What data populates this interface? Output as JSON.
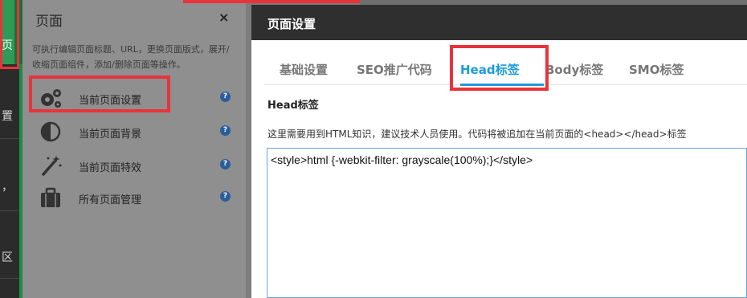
{
  "left_strip": {
    "active_glyph": "页",
    "glyphs": [
      "置",
      "，",
      "区"
    ]
  },
  "page_panel": {
    "title": "页面",
    "close": "×",
    "description": "可执行编辑页面标题、URL，更换页面版式，展开/收缩页面组件，添加/删除页面等操作。",
    "items": [
      {
        "label": "当前页面设置",
        "icon": "gears-icon",
        "help": "?"
      },
      {
        "label": "当前页面背景",
        "icon": "contrast-icon",
        "help": "?"
      },
      {
        "label": "当前页面特效",
        "icon": "magic-wand-icon",
        "help": "?"
      },
      {
        "label": "所有页面管理",
        "icon": "briefcase-icon",
        "help": "?"
      }
    ]
  },
  "dialog": {
    "title": "页面设置",
    "tabs": [
      {
        "label": "基础设置",
        "active": false
      },
      {
        "label": "SEO推广代码",
        "active": false
      },
      {
        "label": "Head标签",
        "active": true
      },
      {
        "label": "Body标签",
        "active": false
      },
      {
        "label": "SMO标签",
        "active": false
      }
    ],
    "section_label": "Head标签",
    "hint": "这里需要用到HTML知识，建议技术人员使用。代码将被追加在当前页面的<head></head>标签",
    "code_value": "<style>html {-webkit-filter: grayscale(100%);}</style>"
  },
  "colors": {
    "accent": "#1b9bdb",
    "highlight_red": "#e9333b",
    "header_dark": "#2f2f2f",
    "green": "#2e9a55",
    "help_blue": "#2a5d99"
  }
}
